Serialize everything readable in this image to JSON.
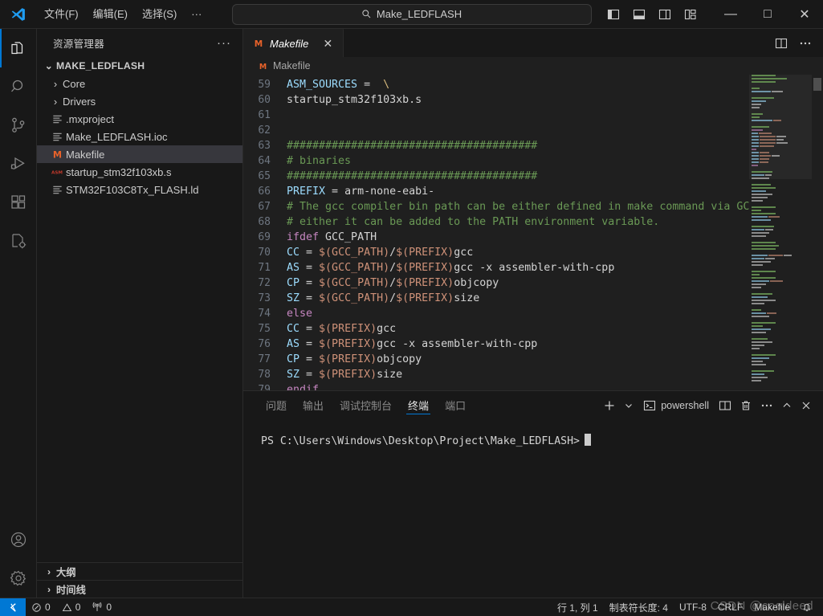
{
  "titlebar": {
    "logo_name": "vscode-logo",
    "menus": [
      {
        "label": "文件(F)",
        "name": "menu-file"
      },
      {
        "label": "编辑(E)",
        "name": "menu-edit"
      },
      {
        "label": "选择(S)",
        "name": "menu-selection"
      },
      {
        "label": "···",
        "name": "menu-more"
      }
    ],
    "nav_back": "←",
    "nav_forward": "→",
    "command_center": {
      "value": "Make_LEDFLASH",
      "icon": "search-icon"
    },
    "layout_buttons": [
      "toggle-primary-sidebar",
      "toggle-panel",
      "toggle-secondary-sidebar",
      "customize-layout"
    ],
    "window_controls": {
      "minimize": "—",
      "maximize": "□",
      "close": "✕"
    }
  },
  "activitybar": {
    "items": [
      {
        "name": "explorer",
        "icon": "files-icon",
        "active": true
      },
      {
        "name": "search",
        "icon": "search-icon",
        "active": false
      },
      {
        "name": "source-control",
        "icon": "source-control-icon",
        "active": false
      },
      {
        "name": "run-and-debug",
        "icon": "run-debug-icon",
        "active": false
      },
      {
        "name": "extensions",
        "icon": "extensions-icon",
        "active": false
      },
      {
        "name": "cpp-config",
        "icon": "cpp-gear-icon",
        "active": false
      }
    ],
    "bottom": [
      {
        "name": "accounts",
        "icon": "account-icon"
      },
      {
        "name": "manage",
        "icon": "gear-icon"
      }
    ]
  },
  "sidebar": {
    "title": "资源管理器",
    "more_actions": "···",
    "root": {
      "label": "MAKE_LEDFLASH",
      "expanded": true,
      "chevron": "⌄"
    },
    "files": [
      {
        "label": "Core",
        "type": "folder",
        "chevron": "›",
        "icon": "folder-icon",
        "selected": false
      },
      {
        "label": "Drivers",
        "type": "folder",
        "chevron": "›",
        "icon": "folder-icon",
        "selected": false
      },
      {
        "label": ".mxproject",
        "type": "file",
        "icon": "text-file-icon",
        "selected": false
      },
      {
        "label": "Make_LEDFLASH.ioc",
        "type": "file",
        "icon": "text-file-icon",
        "selected": false
      },
      {
        "label": "Makefile",
        "type": "file",
        "icon": "makefile-icon",
        "selected": true
      },
      {
        "label": "startup_stm32f103xb.s",
        "type": "file",
        "icon": "asm-file-icon",
        "selected": false
      },
      {
        "label": "STM32F103C8Tx_FLASH.ld",
        "type": "file",
        "icon": "text-file-icon",
        "selected": false
      }
    ],
    "sections": [
      {
        "label": "大纲",
        "chevron": "›",
        "name": "outline-section"
      },
      {
        "label": "时间线",
        "chevron": "›",
        "name": "timeline-section"
      }
    ]
  },
  "editor": {
    "tabs": [
      {
        "label": "Makefile",
        "icon": "makefile-icon",
        "italic": true,
        "close": "✕",
        "active": true
      }
    ],
    "actions": [
      "split-editor",
      "more-actions"
    ],
    "breadcrumb": {
      "icon": "makefile-icon",
      "label": "Makefile"
    },
    "first_line_number": 59,
    "lines": [
      {
        "n": 59,
        "tokens": [
          {
            "t": "ASM_SOURCES",
            "c": "tk-var"
          },
          {
            "t": " = ",
            "c": "tk-op"
          },
          {
            "t": " \\",
            "c": "tk-esc"
          }
        ]
      },
      {
        "n": 60,
        "tokens": [
          {
            "t": "startup_stm32f103xb.s",
            "c": "tk-plain"
          }
        ]
      },
      {
        "n": 61,
        "tokens": []
      },
      {
        "n": 62,
        "tokens": []
      },
      {
        "n": 63,
        "tokens": [
          {
            "t": "#######################################",
            "c": "tk-cmt"
          }
        ]
      },
      {
        "n": 64,
        "tokens": [
          {
            "t": "# binaries",
            "c": "tk-cmt"
          }
        ]
      },
      {
        "n": 65,
        "tokens": [
          {
            "t": "#######################################",
            "c": "tk-cmt"
          }
        ]
      },
      {
        "n": 66,
        "tokens": [
          {
            "t": "PREFIX",
            "c": "tk-var"
          },
          {
            "t": " = ",
            "c": "tk-op"
          },
          {
            "t": "arm-none-eabi-",
            "c": "tk-plain"
          }
        ]
      },
      {
        "n": 67,
        "tokens": [
          {
            "t": "# The gcc compiler bin path can be either defined in make command via GCC",
            "c": "tk-cmt"
          }
        ]
      },
      {
        "n": 68,
        "tokens": [
          {
            "t": "# either it can be added to the PATH environment variable.",
            "c": "tk-cmt"
          }
        ]
      },
      {
        "n": 69,
        "tokens": [
          {
            "t": "ifdef",
            "c": "tk-kw"
          },
          {
            "t": " GCC_PATH",
            "c": "tk-plain"
          }
        ]
      },
      {
        "n": 70,
        "tokens": [
          {
            "t": "CC",
            "c": "tk-var"
          },
          {
            "t": " = ",
            "c": "tk-op"
          },
          {
            "t": "$(GCC_PATH)",
            "c": "tk-ref"
          },
          {
            "t": "/",
            "c": "tk-plain"
          },
          {
            "t": "$(PREFIX)",
            "c": "tk-ref"
          },
          {
            "t": "gcc",
            "c": "tk-plain"
          }
        ]
      },
      {
        "n": 71,
        "tokens": [
          {
            "t": "AS",
            "c": "tk-var"
          },
          {
            "t": " = ",
            "c": "tk-op"
          },
          {
            "t": "$(GCC_PATH)",
            "c": "tk-ref"
          },
          {
            "t": "/",
            "c": "tk-plain"
          },
          {
            "t": "$(PREFIX)",
            "c": "tk-ref"
          },
          {
            "t": "gcc -x assembler-with-cpp",
            "c": "tk-plain"
          }
        ]
      },
      {
        "n": 72,
        "tokens": [
          {
            "t": "CP",
            "c": "tk-var"
          },
          {
            "t": " = ",
            "c": "tk-op"
          },
          {
            "t": "$(GCC_PATH)",
            "c": "tk-ref"
          },
          {
            "t": "/",
            "c": "tk-plain"
          },
          {
            "t": "$(PREFIX)",
            "c": "tk-ref"
          },
          {
            "t": "objcopy",
            "c": "tk-plain"
          }
        ]
      },
      {
        "n": 73,
        "tokens": [
          {
            "t": "SZ",
            "c": "tk-var"
          },
          {
            "t": " = ",
            "c": "tk-op"
          },
          {
            "t": "$(GCC_PATH)",
            "c": "tk-ref"
          },
          {
            "t": "/",
            "c": "tk-plain"
          },
          {
            "t": "$(PREFIX)",
            "c": "tk-ref"
          },
          {
            "t": "size",
            "c": "tk-plain"
          }
        ]
      },
      {
        "n": 74,
        "tokens": [
          {
            "t": "else",
            "c": "tk-kw"
          }
        ]
      },
      {
        "n": 75,
        "tokens": [
          {
            "t": "CC",
            "c": "tk-var"
          },
          {
            "t": " = ",
            "c": "tk-op"
          },
          {
            "t": "$(PREFIX)",
            "c": "tk-ref"
          },
          {
            "t": "gcc",
            "c": "tk-plain"
          }
        ]
      },
      {
        "n": 76,
        "tokens": [
          {
            "t": "AS",
            "c": "tk-var"
          },
          {
            "t": " = ",
            "c": "tk-op"
          },
          {
            "t": "$(PREFIX)",
            "c": "tk-ref"
          },
          {
            "t": "gcc -x assembler-with-cpp",
            "c": "tk-plain"
          }
        ]
      },
      {
        "n": 77,
        "tokens": [
          {
            "t": "CP",
            "c": "tk-var"
          },
          {
            "t": " = ",
            "c": "tk-op"
          },
          {
            "t": "$(PREFIX)",
            "c": "tk-ref"
          },
          {
            "t": "objcopy",
            "c": "tk-plain"
          }
        ]
      },
      {
        "n": 78,
        "tokens": [
          {
            "t": "SZ",
            "c": "tk-var"
          },
          {
            "t": " = ",
            "c": "tk-op"
          },
          {
            "t": "$(PREFIX)",
            "c": "tk-ref"
          },
          {
            "t": "size",
            "c": "tk-plain"
          }
        ]
      },
      {
        "n": 79,
        "tokens": [
          {
            "t": "endif",
            "c": "tk-kw"
          }
        ]
      }
    ]
  },
  "panel": {
    "tabs": [
      {
        "label": "问题",
        "name": "tab-problems",
        "active": false
      },
      {
        "label": "输出",
        "name": "tab-output",
        "active": false
      },
      {
        "label": "调试控制台",
        "name": "tab-debug-console",
        "active": false
      },
      {
        "label": "终端",
        "name": "tab-terminal",
        "active": true
      },
      {
        "label": "端口",
        "name": "tab-ports",
        "active": false
      }
    ],
    "actions": {
      "new_terminal": "+",
      "new_terminal_dropdown": "⌄",
      "shell_label": "powershell",
      "split": "split-terminal",
      "kill": "trash-icon",
      "more": "···",
      "maximize": "^",
      "close": "✕"
    },
    "terminal": {
      "prompt_prefix": "PS ",
      "prompt_path": "C:\\Users\\Windows\\Desktop\\Project\\Make_LEDFLASH>",
      "command": ""
    }
  },
  "statusbar": {
    "remote_icon": "remote-indicator-icon",
    "left": [
      {
        "icon": "error-icon",
        "value": "0",
        "name": "error-count"
      },
      {
        "icon": "warning-icon",
        "value": "0",
        "name": "warning-count"
      },
      {
        "icon": "radio-tower-icon",
        "value": "0",
        "name": "ports-count"
      }
    ],
    "right": [
      {
        "label": "行 1, 列 1",
        "name": "cursor-position"
      },
      {
        "label": "制表符长度: 4",
        "name": "indentation"
      },
      {
        "label": "UTF-8",
        "name": "encoding"
      },
      {
        "label": "CRLF",
        "name": "eol"
      },
      {
        "label": "Makefile",
        "name": "language-mode"
      },
      {
        "label": "",
        "icon": "bell-icon",
        "name": "notifications"
      }
    ]
  },
  "watermark": "CSDN @cooldeed",
  "colors": {
    "accent": "#0078d4",
    "titlebar_bg": "#181818",
    "editor_bg": "#1f1f1f",
    "sidebar_bg": "#181818",
    "selection_bg": "#37373d",
    "comment": "#6a9955",
    "variable": "#9cdcfe",
    "reference": "#ce9178",
    "keyword": "#c586c0",
    "makefile_icon": "#e8622a"
  }
}
